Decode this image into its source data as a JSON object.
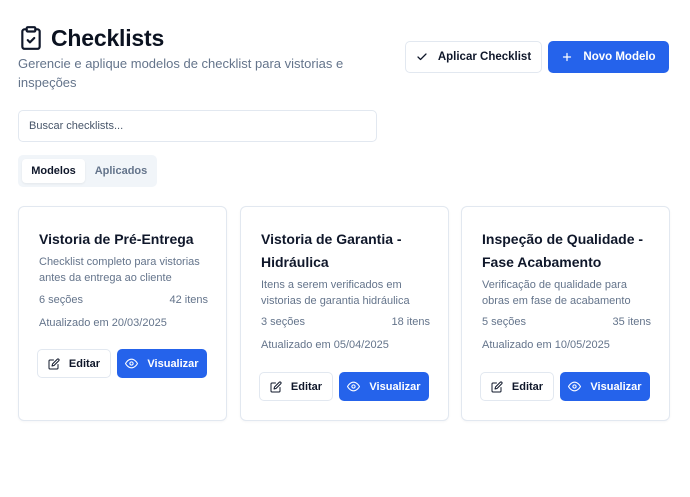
{
  "header": {
    "title": "Checklists",
    "subtitle": "Gerencie e aplique modelos de checklist para vistorias e inspeções",
    "apply_label": "Aplicar Checklist",
    "new_label": "Novo Modelo"
  },
  "search": {
    "placeholder": "Buscar checklists...",
    "value": ""
  },
  "tabs": [
    {
      "label": "Modelos",
      "active": true
    },
    {
      "label": "Aplicados",
      "active": false
    }
  ],
  "cards": [
    {
      "title": "Vistoria de Pré-Entrega",
      "description": "Checklist completo para vistorias antes da entrega ao cliente",
      "sections": "6 seções",
      "items": "42 itens",
      "updated": "Atualizado em 20/03/2025",
      "edit_label": "Editar",
      "view_label": "Visualizar"
    },
    {
      "title": "Vistoria de Garantia - Hidráulica",
      "description": "Itens a serem verificados em vistorias de garantia hidráulica",
      "sections": "3 seções",
      "items": "18 itens",
      "updated": "Atualizado em 05/04/2025",
      "edit_label": "Editar",
      "view_label": "Visualizar"
    },
    {
      "title": "Inspeção de Qualidade - Fase Acabamento",
      "description": "Verificação de qualidade para obras em fase de acabamento",
      "sections": "5 seções",
      "items": "35 itens",
      "updated": "Atualizado em 10/05/2025",
      "edit_label": "Editar",
      "view_label": "Visualizar"
    }
  ],
  "colors": {
    "primary": "#2563eb",
    "border": "#e2e8f0",
    "muted_text": "#64748b",
    "tab_bg": "#f1f5f9"
  },
  "icons": {
    "title": "clipboard-check-icon",
    "apply": "check-icon",
    "new": "plus-icon",
    "edit": "pencil-square-icon",
    "view": "eye-icon"
  }
}
